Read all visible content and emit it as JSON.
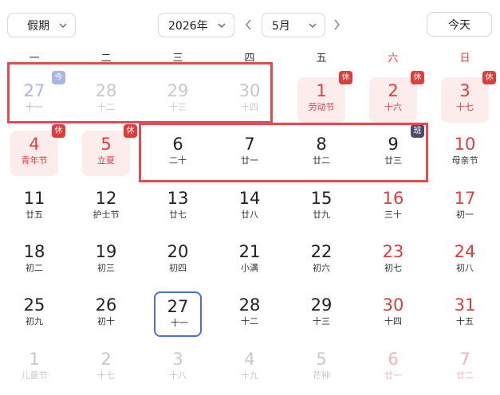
{
  "toolbar": {
    "holiday_select": "假期",
    "year_select": "2026年",
    "month_select": "5月",
    "today_button": "今天"
  },
  "weekdays": [
    "一",
    "二",
    "三",
    "四",
    "五",
    "六",
    "日"
  ],
  "weekend_color": "#e03c3c",
  "rest_badge_color": "#e03c3c",
  "work_badge_color": "#4a4e6e",
  "today_border_color": "#4a6fdc",
  "highlight_color": "#e8484f",
  "weeks": [
    [
      {
        "day": "27",
        "sub": "十一",
        "dim": true,
        "badge": "今",
        "badge_type": "today"
      },
      {
        "day": "28",
        "sub": "十二",
        "dim": true
      },
      {
        "day": "29",
        "sub": "十三",
        "dim": true
      },
      {
        "day": "30",
        "sub": "十四",
        "dim": true
      },
      {
        "day": "1",
        "sub": "劳动节",
        "rest": true,
        "badge": "休",
        "badge_type": "rest"
      },
      {
        "day": "2",
        "sub": "十六",
        "rest": true,
        "badge": "休",
        "badge_type": "rest"
      },
      {
        "day": "3",
        "sub": "十七",
        "rest": true,
        "badge": "休",
        "badge_type": "rest"
      }
    ],
    [
      {
        "day": "4",
        "sub": "青年节",
        "rest": true,
        "badge": "休",
        "badge_type": "rest"
      },
      {
        "day": "5",
        "sub": "立夏",
        "rest": true,
        "badge": "休",
        "badge_type": "rest"
      },
      {
        "day": "6",
        "sub": "二十"
      },
      {
        "day": "7",
        "sub": "廿一"
      },
      {
        "day": "8",
        "sub": "廿二"
      },
      {
        "day": "9",
        "sub": "廿三",
        "badge": "班",
        "badge_type": "work",
        "weekend": false
      },
      {
        "day": "10",
        "sub": "母亲节"
      }
    ],
    [
      {
        "day": "11",
        "sub": "廿五"
      },
      {
        "day": "12",
        "sub": "护士节"
      },
      {
        "day": "13",
        "sub": "廿七"
      },
      {
        "day": "14",
        "sub": "廿八"
      },
      {
        "day": "15",
        "sub": "廿九"
      },
      {
        "day": "16",
        "sub": "三十"
      },
      {
        "day": "17",
        "sub": "初一"
      }
    ],
    [
      {
        "day": "18",
        "sub": "初二"
      },
      {
        "day": "19",
        "sub": "初三"
      },
      {
        "day": "20",
        "sub": "初四"
      },
      {
        "day": "21",
        "sub": "小满"
      },
      {
        "day": "22",
        "sub": "初六"
      },
      {
        "day": "23",
        "sub": "初七"
      },
      {
        "day": "24",
        "sub": "初八"
      }
    ],
    [
      {
        "day": "25",
        "sub": "初九"
      },
      {
        "day": "26",
        "sub": "初十"
      },
      {
        "day": "27",
        "sub": "十一",
        "today": true
      },
      {
        "day": "28",
        "sub": "十二"
      },
      {
        "day": "29",
        "sub": "十三"
      },
      {
        "day": "30",
        "sub": "十四"
      },
      {
        "day": "31",
        "sub": "十五"
      }
    ],
    [
      {
        "day": "1",
        "sub": "儿童节",
        "dim": true
      },
      {
        "day": "2",
        "sub": "十七",
        "dim": true
      },
      {
        "day": "3",
        "sub": "十八",
        "dim": true
      },
      {
        "day": "4",
        "sub": "十九",
        "dim": true
      },
      {
        "day": "5",
        "sub": "芒种",
        "dim": true
      },
      {
        "day": "6",
        "sub": "廿一",
        "dim": true
      },
      {
        "day": "7",
        "sub": "廿二",
        "dim": true
      }
    ]
  ]
}
